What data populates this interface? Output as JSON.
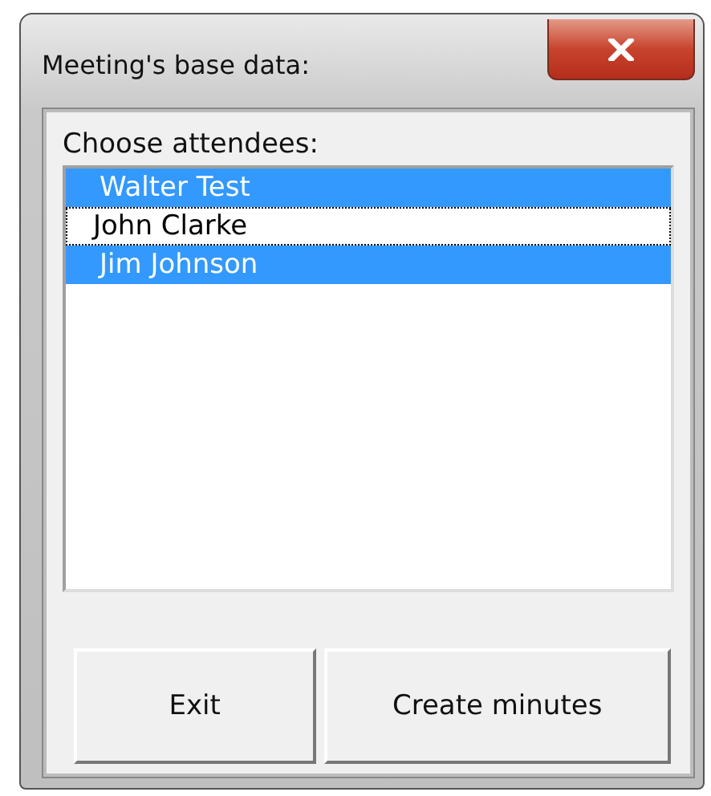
{
  "window": {
    "title": "Meeting's base data:"
  },
  "attendees": {
    "label": "Choose attendees:",
    "items": [
      {
        "name": "Walter Test",
        "selected": true,
        "focused": false
      },
      {
        "name": "John Clarke",
        "selected": false,
        "focused": true
      },
      {
        "name": "Jim Johnson",
        "selected": true,
        "focused": false
      }
    ]
  },
  "buttons": [
    {
      "label": "Exit"
    },
    {
      "label": "Create minutes"
    }
  ]
}
